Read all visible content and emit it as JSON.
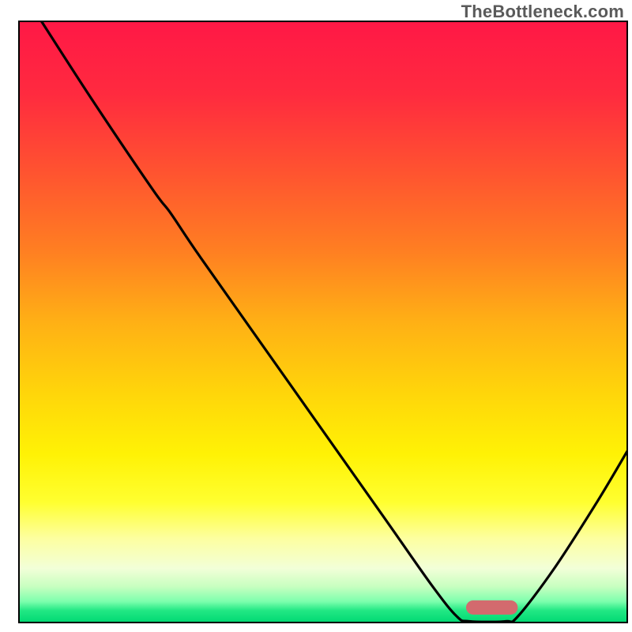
{
  "attribution": "TheBottleneck.com",
  "chart_data": {
    "type": "line",
    "title": "",
    "xlabel": "",
    "ylabel": "",
    "xlim": [
      0,
      100
    ],
    "ylim": [
      0,
      100
    ],
    "background_gradient_stops": [
      {
        "offset": 0,
        "color": "#ff1846"
      },
      {
        "offset": 12,
        "color": "#ff2a3f"
      },
      {
        "offset": 25,
        "color": "#ff5330"
      },
      {
        "offset": 38,
        "color": "#ff7e22"
      },
      {
        "offset": 50,
        "color": "#ffb015"
      },
      {
        "offset": 62,
        "color": "#ffd60a"
      },
      {
        "offset": 72,
        "color": "#fff205"
      },
      {
        "offset": 80,
        "color": "#ffff30"
      },
      {
        "offset": 86,
        "color": "#fdffa0"
      },
      {
        "offset": 91,
        "color": "#f2ffd8"
      },
      {
        "offset": 94,
        "color": "#c8ffc0"
      },
      {
        "offset": 96.5,
        "color": "#7dffad"
      },
      {
        "offset": 98,
        "color": "#22e884"
      },
      {
        "offset": 100,
        "color": "#00d873"
      }
    ],
    "curve_points": [
      {
        "x": 3.7,
        "y": 100.0
      },
      {
        "x": 12.0,
        "y": 87.0
      },
      {
        "x": 22.0,
        "y": 72.0
      },
      {
        "x": 25.0,
        "y": 68.0
      },
      {
        "x": 30.0,
        "y": 60.5
      },
      {
        "x": 45.0,
        "y": 39.0
      },
      {
        "x": 60.0,
        "y": 17.5
      },
      {
        "x": 68.0,
        "y": 6.0
      },
      {
        "x": 72.0,
        "y": 1.0
      },
      {
        "x": 74.0,
        "y": 0.2
      },
      {
        "x": 80.0,
        "y": 0.2
      },
      {
        "x": 82.0,
        "y": 1.0
      },
      {
        "x": 88.0,
        "y": 9.0
      },
      {
        "x": 95.0,
        "y": 20.0
      },
      {
        "x": 100.0,
        "y": 28.5
      }
    ],
    "marker": {
      "x_start": 73.5,
      "x_end": 82.0,
      "y": 2.5,
      "color": "#d36a6e"
    },
    "frame": {
      "x0": 24,
      "y0": 27,
      "x1": 794,
      "y1": 788,
      "stroke": "#000000",
      "stroke_width": 2
    }
  }
}
